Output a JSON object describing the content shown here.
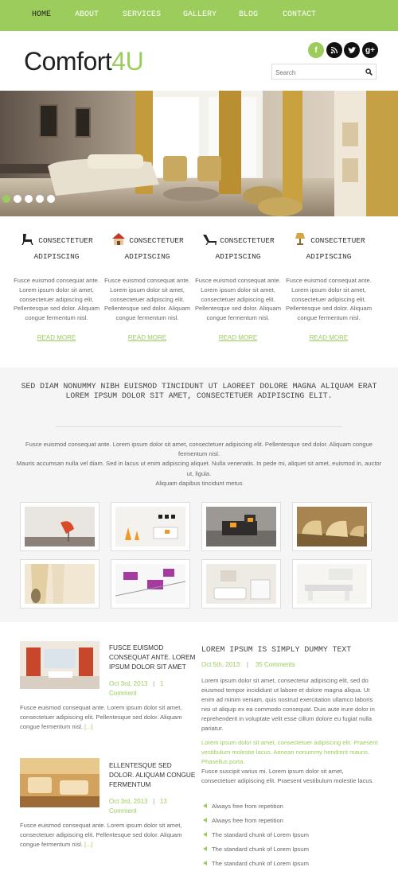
{
  "nav": {
    "items": [
      "HOME",
      "ABOUT",
      "SERVICES",
      "GALLERY",
      "BLOG",
      "CONTACT"
    ]
  },
  "logo": {
    "part1": "Comfort",
    "part2": "4U"
  },
  "social": [
    "f",
    "rss",
    "t",
    "g+"
  ],
  "search": {
    "placeholder": "Search"
  },
  "slider": {
    "dots": 5,
    "active": 0
  },
  "features": [
    {
      "icon": "chair-icon",
      "title1": "CONSECTETUER",
      "title2": "ADIPISCING",
      "text": "Fusce euismod consequat ante. Lorem ipsum dolor sit amet, consectetuer adipiscing elit. Pellentesque sed dolor. Aliquam congue fermentum nisl.",
      "more": "READ MORE"
    },
    {
      "icon": "house-icon",
      "title1": "CONSECTETUER",
      "title2": "ADIPISCING",
      "text": "Fusce euismod consequat ante. Lorem ipsum dolor sit amet, consectetuer adipiscing elit. Pellentesque sed dolor. Aliquam congue fermentum nisl.",
      "more": "READ MORE"
    },
    {
      "icon": "lounge-chair-icon",
      "title1": "CONSECTETUER",
      "title2": "ADIPISCING",
      "text": "Fusce euismod consequat ante. Lorem ipsum dolor sit amet, consectetuer adipiscing elit. Pellentesque sed dolor. Aliquam congue fermentum nisl.",
      "more": "READ MORE"
    },
    {
      "icon": "lamp-icon",
      "title1": "CONSECTETUER",
      "title2": "ADIPISCING",
      "text": "Fusce euismod consequat ante. Lorem ipsum dolor sit amet, consectetuer adipiscing elit. Pellentesque sed dolor. Aliquam congue fermentum nisl.",
      "more": "READ MORE"
    }
  ],
  "intro": {
    "heading1": "SED DIAM NONUMMY NIBH EUISMOD TINCIDUNT UT LAOREET DOLORE MAGNA ALIQUAM ERAT",
    "heading2": "LOREM IPSUM DOLOR SIT AMET, CONSECTETUER ADIPISCING ELIT.",
    "line1": "Fusce euismod consequat ante. Lorem ipsum dolor sit amet, consectetuer adipiscing elit. Pellentesque sed dolor. Aliquam congue fermentum nisl.",
    "line2": "Mauris accumsan nulla vel diam. Sed in lacus ut enim adipiscing aliquet. Nulla venenatis. In pede mi, aliquet sit amet, euismod in, auctor ut, ligula.",
    "line3": "Aliquam dapibus tincidunt metus"
  },
  "posts": [
    {
      "title": "FUSCE EUISMOD CONSEQUAT ANTE. LOREM IPSUM DOLOR SIT AMET",
      "date": "Oct 3rd, 2013",
      "sep": "|",
      "comments": "1",
      "comments_word": "Comment",
      "text": "Fusce euismod consequat ante. Lorem ipsum dolor sit amet, consectetuer adipiscing elit. Pellentesque sed dolor. Aliquam congue fermentum nisl.",
      "more": "[...]"
    },
    {
      "title": "ELLENTESQUE SED DOLOR. ALIQUAM CONGUE FERMENTUM",
      "date": "Oct 3rd, 2013",
      "sep": "|",
      "comments": "13",
      "comments_word": "Comment",
      "text": "Fusce euismod consequat ante. Lorem ipsum dolor sit amet, consectetuer adipiscing elit. Pellentesque sed dolor. Aliquam congue fermentum nisl.",
      "more": "[...]"
    }
  ],
  "right": {
    "heading": "LOREM IPSUM IS SIMPLY DUMMY TEXT",
    "date": "Oct 5th, 2013",
    "sep": "|",
    "comments": "35 Comments",
    "para1": "Lorem ipsum dolor sit amet, consectetur adipiscing elit, sed do eiusmod tempor incididunt ut labore et dolore magna aliqua. Ut enim ad minim veniam, quis nostrud exercitation ullamco laboris nisi ut aliquip ex ea commodo consequat. Duis aute irure dolor in reprehenderit in voluptate velit esse cillum dolore eu fugiat nulla pariatur.",
    "green": "Lorem ipsum dolor sit amet, consectetuer adipiscing elit. Praesent vestibulum molestie lacus. Aenean nonummy hendrerit mauris. Phasellus porta.",
    "para2": "Fusce suscipit varius mi. Lorem ipsum dolor sit amet, consectetuer adipiscing elit. Praesent vestibulum molestie lacus.",
    "list": [
      "Always free from repetition",
      "Always free from repetition",
      "The standard chunk of Lorem Ipsum",
      "The standard chunk of Lorem Ipsum",
      "The standard chunk of Lorem Ipsum"
    ]
  },
  "colors": {
    "accent": "#9ccc5b",
    "text": "#666666",
    "heading": "#333333"
  }
}
